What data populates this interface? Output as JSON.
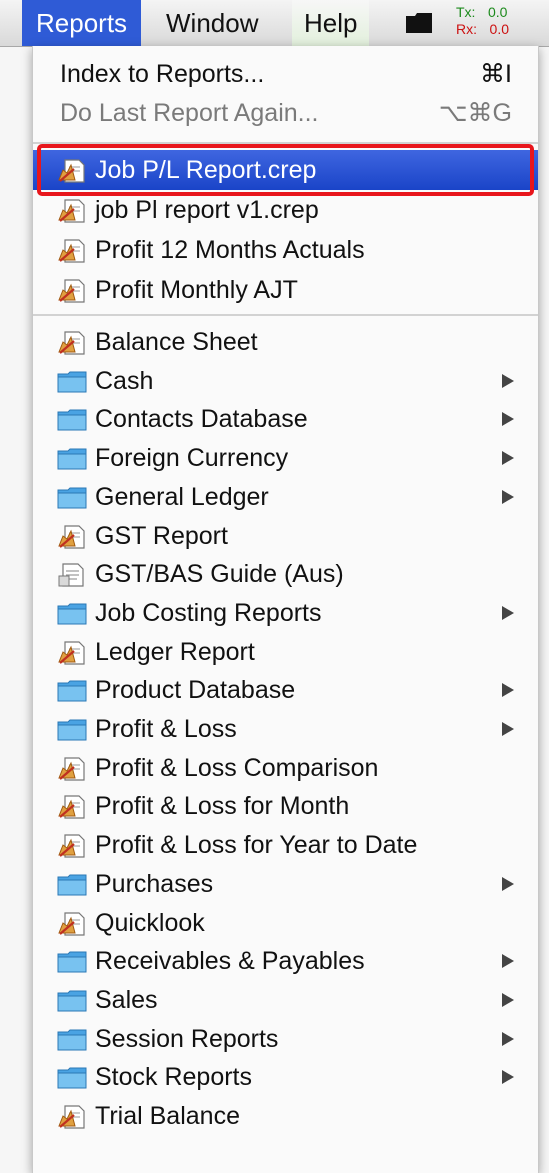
{
  "menubar": {
    "items": [
      "Reports",
      "Window",
      "Help"
    ],
    "net": {
      "tx_label": "Tx:",
      "tx_value": "0.0",
      "rx_label": "Rx:",
      "rx_value": "0.0"
    }
  },
  "menu": {
    "top_items": [
      {
        "label": "Index to Reports...",
        "shortcut": "⌘I",
        "enabled": true
      },
      {
        "label": "Do Last Report Again...",
        "shortcut": "⌥⌘G",
        "enabled": false
      }
    ],
    "recent": [
      {
        "label": "Job P/L Report.crep",
        "icon": "report-icon",
        "selected": true
      },
      {
        "label": "job Pl report v1.crep",
        "icon": "report-icon"
      },
      {
        "label": "Profit 12 Months Actuals",
        "icon": "report-icon"
      },
      {
        "label": "Profit Monthly AJT",
        "icon": "report-icon"
      }
    ],
    "reports": [
      {
        "label": "Balance Sheet",
        "icon": "report-icon",
        "submenu": false
      },
      {
        "label": "Cash",
        "icon": "folder-icon",
        "submenu": true
      },
      {
        "label": "Contacts Database",
        "icon": "folder-icon",
        "submenu": true
      },
      {
        "label": "Foreign Currency",
        "icon": "folder-icon",
        "submenu": true
      },
      {
        "label": "General Ledger",
        "icon": "folder-icon",
        "submenu": true
      },
      {
        "label": "GST Report",
        "icon": "report-icon",
        "submenu": false
      },
      {
        "label": "GST/BAS Guide (Aus)",
        "icon": "document-icon",
        "submenu": false
      },
      {
        "label": "Job Costing Reports",
        "icon": "folder-icon",
        "submenu": true
      },
      {
        "label": "Ledger Report",
        "icon": "report-icon",
        "submenu": false
      },
      {
        "label": "Product Database",
        "icon": "folder-icon",
        "submenu": true
      },
      {
        "label": "Profit & Loss",
        "icon": "folder-icon",
        "submenu": true
      },
      {
        "label": "Profit & Loss Comparison",
        "icon": "report-icon",
        "submenu": false
      },
      {
        "label": "Profit & Loss for Month",
        "icon": "report-icon",
        "submenu": false
      },
      {
        "label": "Profit & Loss for Year to Date",
        "icon": "report-icon",
        "submenu": false
      },
      {
        "label": "Purchases",
        "icon": "folder-icon",
        "submenu": true
      },
      {
        "label": "Quicklook",
        "icon": "report-icon",
        "submenu": false
      },
      {
        "label": "Receivables & Payables",
        "icon": "folder-icon",
        "submenu": true
      },
      {
        "label": "Sales",
        "icon": "folder-icon",
        "submenu": true
      },
      {
        "label": "Session Reports",
        "icon": "folder-icon",
        "submenu": true
      },
      {
        "label": "Stock Reports",
        "icon": "folder-icon",
        "submenu": true
      },
      {
        "label": "Trial Balance",
        "icon": "report-icon",
        "submenu": false
      }
    ]
  },
  "colors": {
    "selection": "#2f5bd6",
    "highlight_outline": "#e8161c",
    "folder": "#5aaee8"
  }
}
